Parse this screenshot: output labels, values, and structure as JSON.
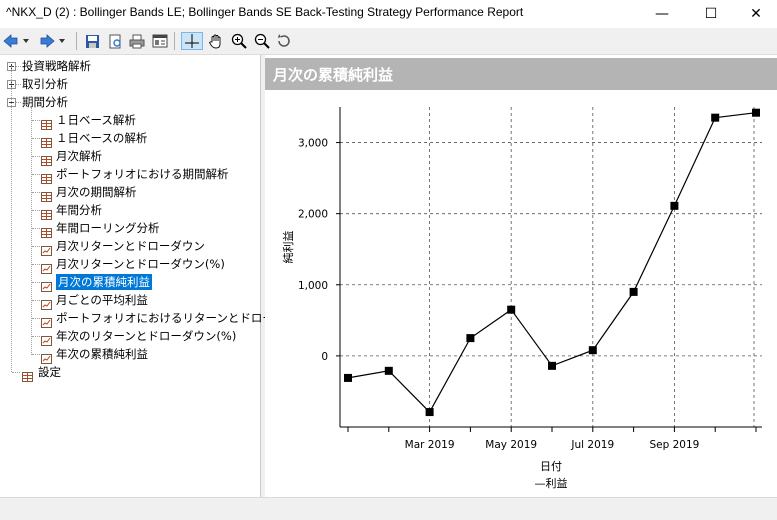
{
  "window": {
    "title": "^NKX_D (2) : Bollinger Bands LE; Bollinger Bands SE Back-Testing Strategy Performance Report",
    "minimize": "—",
    "maximize": "☐",
    "close": "✕"
  },
  "tree": {
    "top": [
      {
        "label": "投資戦略解析",
        "expanded": false
      },
      {
        "label": "取引分析",
        "expanded": false
      },
      {
        "label": "期間分析",
        "expanded": true
      }
    ],
    "children": [
      {
        "label": "１日ベース解析",
        "icon": "table"
      },
      {
        "label": "１日ベースの解析",
        "icon": "table"
      },
      {
        "label": "月次解析",
        "icon": "table"
      },
      {
        "label": "ポートフォリオにおける期間解析",
        "icon": "table"
      },
      {
        "label": "月次の期間解析",
        "icon": "table"
      },
      {
        "label": "年間分析",
        "icon": "table"
      },
      {
        "label": "年間ローリング分析",
        "icon": "table"
      },
      {
        "label": "月次リターンとドローダウン",
        "icon": "chart"
      },
      {
        "label": "月次リターンとドローダウン(%)",
        "icon": "chart"
      },
      {
        "label": "月次の累積純利益",
        "icon": "chart",
        "selected": true
      },
      {
        "label": "月ごとの平均利益",
        "icon": "chart"
      },
      {
        "label": "ポートフォリオにおけるリターンとドローダウン",
        "icon": "chart"
      },
      {
        "label": "年次のリターンとドローダウン(%)",
        "icon": "chart"
      },
      {
        "label": "年次の累積純利益",
        "icon": "chart"
      }
    ],
    "last": {
      "label": "設定",
      "icon": "table"
    }
  },
  "content": {
    "banner_title": "月次の累積純利益"
  },
  "chart_data": {
    "type": "line",
    "title": "",
    "xlabel": "日付",
    "ylabel": "純利益",
    "legend": "—利益",
    "legend_position": "bottom-center",
    "grid": true,
    "ylim": [
      -1000,
      3500
    ],
    "x_tick_labels": [
      "Mar 2019",
      "May 2019",
      "Jul 2019",
      "Sep 2019"
    ],
    "y_tick_labels": [
      "0",
      "1,000",
      "2,000",
      "3,000"
    ],
    "y_tick_values": [
      0,
      1000,
      2000,
      3000
    ],
    "series": [
      {
        "values": [
          -310,
          -210,
          -790,
          250,
          650,
          -140,
          80,
          900,
          2110,
          3350,
          3420
        ],
        "color": "#000000",
        "marker": "square"
      }
    ]
  }
}
